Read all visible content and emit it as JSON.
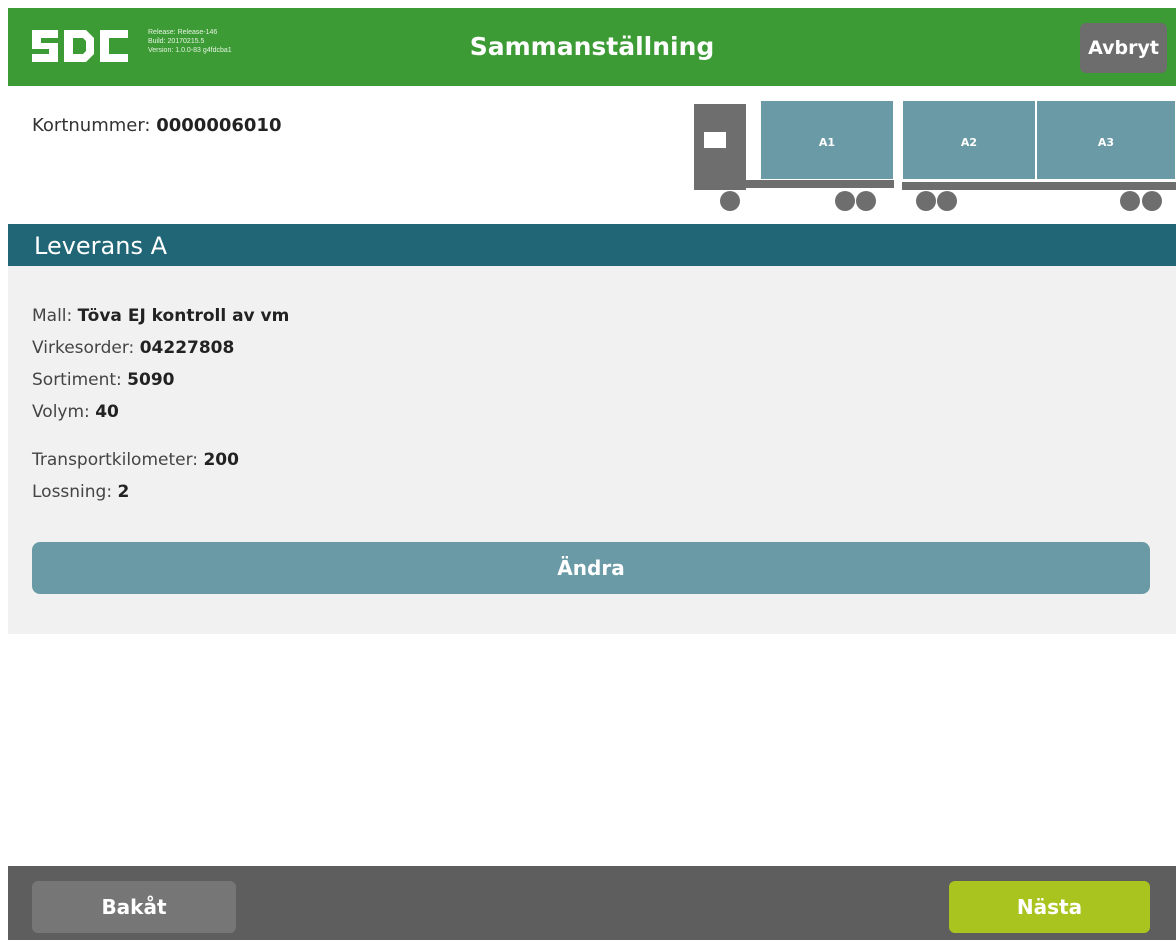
{
  "header": {
    "logo_text": "SDC",
    "release_lines": [
      "Release: Release-146",
      "Build: 20170215.5",
      "Version: 1.0.0-83 g4fdcba1"
    ],
    "title": "Sammanställning",
    "cancel_label": "Avbryt",
    "brand_color": "#3c9b35"
  },
  "card": {
    "label": "Kortnummer:",
    "value": "0000006010"
  },
  "truck": {
    "compartments": [
      "A1",
      "A2",
      "A3"
    ]
  },
  "section": {
    "title": "Leverans A",
    "color": "#216677"
  },
  "delivery": {
    "fields": [
      {
        "label": "Mall:",
        "value": "Töva EJ kontroll av vm"
      },
      {
        "label": "Virkesorder:",
        "value": "04227808"
      },
      {
        "label": "Sortiment:",
        "value": "5090"
      },
      {
        "label": "Volym:",
        "value": "40"
      },
      {
        "label": "Transportkilometer:",
        "value": "200"
      },
      {
        "label": "Lossning:",
        "value": "2"
      }
    ],
    "change_label": "Ändra"
  },
  "footer": {
    "back_label": "Bakåt",
    "next_label": "Nästa",
    "next_color": "#a9c41f"
  }
}
